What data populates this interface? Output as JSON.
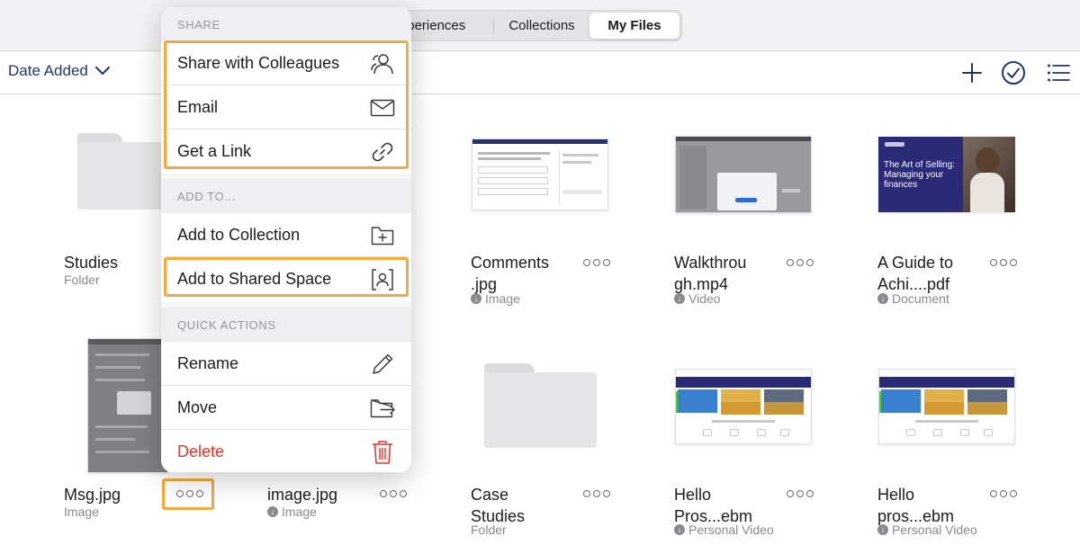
{
  "tabs": {
    "experiences": "Experiences",
    "collections": "Collections",
    "my_files": "My Files"
  },
  "toolbar": {
    "sort_label": "Date Added"
  },
  "menu": {
    "share_header": "SHARE",
    "share_colleagues": "Share with Colleagues",
    "email": "Email",
    "get_link": "Get a Link",
    "add_to_header": "ADD TO...",
    "add_collection": "Add to Collection",
    "add_shared_space": "Add to Shared Space",
    "quick_header": "QUICK ACTIONS",
    "rename": "Rename",
    "move": "Move",
    "delete": "Delete"
  },
  "items": [
    {
      "title": "Studies",
      "subtitle": "Folder"
    },
    {
      "title": "Comments\n.jpg",
      "line1": "Comments",
      "line2": ".jpg",
      "subtitle": "Image"
    },
    {
      "line1": "Walkthrou",
      "line2": "gh.mp4",
      "subtitle": "Video"
    },
    {
      "line1": "A Guide to",
      "line2": "Achi....pdf",
      "subtitle": "Document"
    },
    {
      "title": "Msg.jpg",
      "subtitle": "Image"
    },
    {
      "title": "image.jpg",
      "subtitle": "Image"
    },
    {
      "line1": "Case",
      "line2": "Studies",
      "subtitle": "Folder"
    },
    {
      "line1": "Hello",
      "line2": "Pros...ebm",
      "subtitle": "Personal Video"
    },
    {
      "line1": "Hello",
      "line2": "pros...ebm",
      "subtitle": "Personal Video"
    }
  ],
  "thumb_text": {
    "guide_line1": "The Art of Selling:",
    "guide_line2": "Managing your",
    "guide_line3": "finances"
  },
  "colors": {
    "accent": "#24346e",
    "highlight": "#f3a93b",
    "danger": "#e5332a"
  }
}
